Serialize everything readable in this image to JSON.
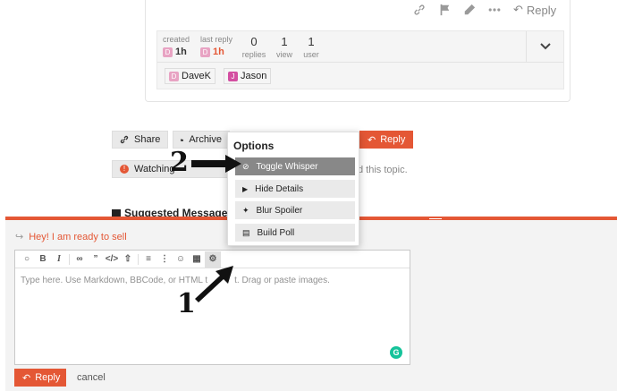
{
  "post": {
    "actions": [
      "link-icon",
      "flag-icon",
      "edit-icon",
      "more-icon"
    ],
    "reply_label": "Reply"
  },
  "topic_map": {
    "created_label": "created",
    "created_avatar": "D",
    "created_value": "1h",
    "last_reply_label": "last reply",
    "last_reply_avatar": "D",
    "last_reply_value": "1h",
    "stats": [
      {
        "number": "0",
        "label": "replies"
      },
      {
        "number": "1",
        "label": "view"
      },
      {
        "number": "1",
        "label": "user"
      }
    ],
    "users": [
      {
        "avatar": "D",
        "name": "DaveK"
      },
      {
        "avatar": "J",
        "name": "Jason"
      }
    ]
  },
  "footer": {
    "share_label": "Share",
    "archive_label": "Archive",
    "reply_label": "Reply",
    "watching_label": "Watching",
    "notification_text": "d this topic."
  },
  "suggested": {
    "title": "Suggested Messages"
  },
  "options": {
    "title": "Options",
    "items": [
      {
        "label": "Toggle Whisper",
        "icon": "eye-slash-icon"
      },
      {
        "label": "Hide Details",
        "icon": "caret-right-icon"
      },
      {
        "label": "Blur Spoiler",
        "icon": "magic-icon"
      },
      {
        "label": "Build Poll",
        "icon": "chart-icon"
      }
    ]
  },
  "composer": {
    "reply_to": "Hey! I am ready to sell",
    "placeholder": "Type here. Use Markdown, BBCode, or HTML t",
    "placeholder_tail": "t. Drag or paste images.",
    "submit_label": "Reply",
    "cancel_label": "cancel",
    "grammarly": "G"
  },
  "annotations": {
    "step1": "1",
    "step2": "2"
  },
  "colors": {
    "accent": "#e45735",
    "grammarly": "#15c39a"
  }
}
